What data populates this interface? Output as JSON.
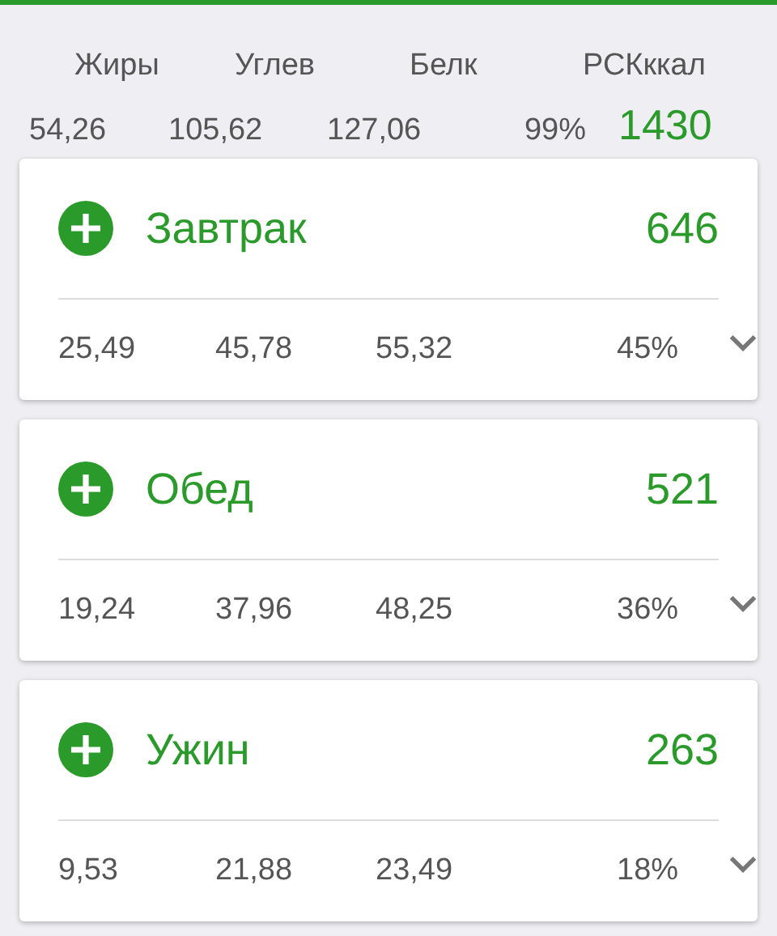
{
  "summary": {
    "labels": [
      "Жиры",
      "Углев",
      "Белк",
      "РСКккал"
    ],
    "values": [
      "54,26",
      "105,62",
      "127,06",
      "99%"
    ],
    "kcal": "1430"
  },
  "meals": [
    {
      "name": "Завтрак",
      "kcal": "646",
      "stats": [
        "25,49",
        "45,78",
        "55,32",
        "45%"
      ],
      "expanded": false
    },
    {
      "name": "Обед",
      "kcal": "521",
      "stats": [
        "19,24",
        "37,96",
        "48,25",
        "36%"
      ],
      "expanded": false
    },
    {
      "name": "Ужин",
      "kcal": "263",
      "stats": [
        "9,53",
        "21,88",
        "23,49",
        "18%"
      ],
      "expanded": false
    }
  ]
}
